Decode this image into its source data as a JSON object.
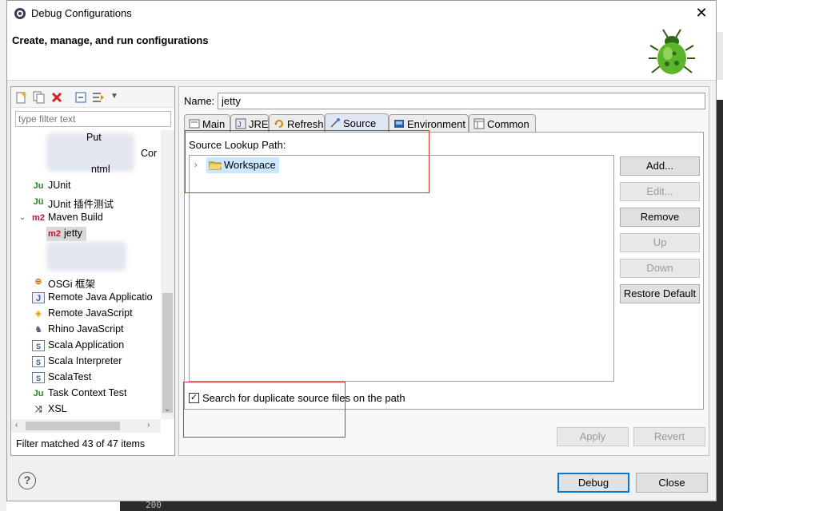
{
  "window": {
    "title": "Debug Configurations",
    "icon": "debug-app-icon",
    "close": "✕"
  },
  "banner": {
    "heading": "Create, manage, and run configurations",
    "image": "bug-icon"
  },
  "left": {
    "filter_placeholder": "type filter text",
    "tree": [
      {
        "label": "JUnit",
        "icon": "junit-icon",
        "indent": 1
      },
      {
        "label": "JUnit 插件测试",
        "icon": "junit-plugin-icon",
        "indent": 1
      },
      {
        "label": "Maven Build",
        "icon": "m2-icon",
        "indent": 1,
        "expanded": true
      },
      {
        "label": "jetty",
        "icon": "m2-icon",
        "indent": 2,
        "selected": true
      },
      {
        "label": "OSGi 框架",
        "icon": "osgi-icon",
        "indent": 1
      },
      {
        "label": "Remote Java Applicatio",
        "icon": "remote-java-icon",
        "indent": 1
      },
      {
        "label": "Remote JavaScript",
        "icon": "remote-js-icon",
        "indent": 1
      },
      {
        "label": "Rhino JavaScript",
        "icon": "rhino-icon",
        "indent": 1
      },
      {
        "label": "Scala Application",
        "icon": "scala-icon",
        "indent": 1
      },
      {
        "label": "Scala Interpreter",
        "icon": "scala-icon",
        "indent": 1
      },
      {
        "label": "ScalaTest",
        "icon": "scala-icon",
        "indent": 1
      },
      {
        "label": "Task Context Test",
        "icon": "junit-icon",
        "indent": 1
      },
      {
        "label": "XSL",
        "icon": "xsl-icon",
        "indent": 1
      }
    ],
    "partial_texts": [
      "Put",
      "Cor",
      "ntml"
    ],
    "filter_status": "Filter matched 43 of 47 items"
  },
  "right": {
    "name_label": "Name:",
    "name_value": "jetty",
    "tabs": [
      {
        "label": "Main",
        "icon": "main-tab-icon"
      },
      {
        "label": "JRE",
        "icon": "jre-tab-icon"
      },
      {
        "label": "Refresh",
        "icon": "refresh-tab-icon"
      },
      {
        "label": "Source",
        "icon": "source-tab-icon",
        "active": true
      },
      {
        "label": "Environment",
        "icon": "environment-tab-icon"
      },
      {
        "label": "Common",
        "icon": "common-tab-icon"
      }
    ],
    "source_lookup_label": "Source Lookup Path:",
    "workspace_label": "Workspace",
    "buttons": {
      "add": "Add...",
      "edit": "Edit...",
      "remove": "Remove",
      "up": "Up",
      "down": "Down",
      "restore": "Restore Default"
    },
    "duplicate_search_label": "Search for duplicate source files on the path",
    "duplicate_search_checked": true,
    "apply": "Apply",
    "revert": "Revert"
  },
  "footer": {
    "help": "?",
    "debug": "Debug",
    "close": "Close"
  },
  "background": {
    "line_number": "200"
  },
  "colors": {
    "selection": "#cce8ff",
    "annotation": "#dd3333",
    "default_button": "#0078d7"
  }
}
